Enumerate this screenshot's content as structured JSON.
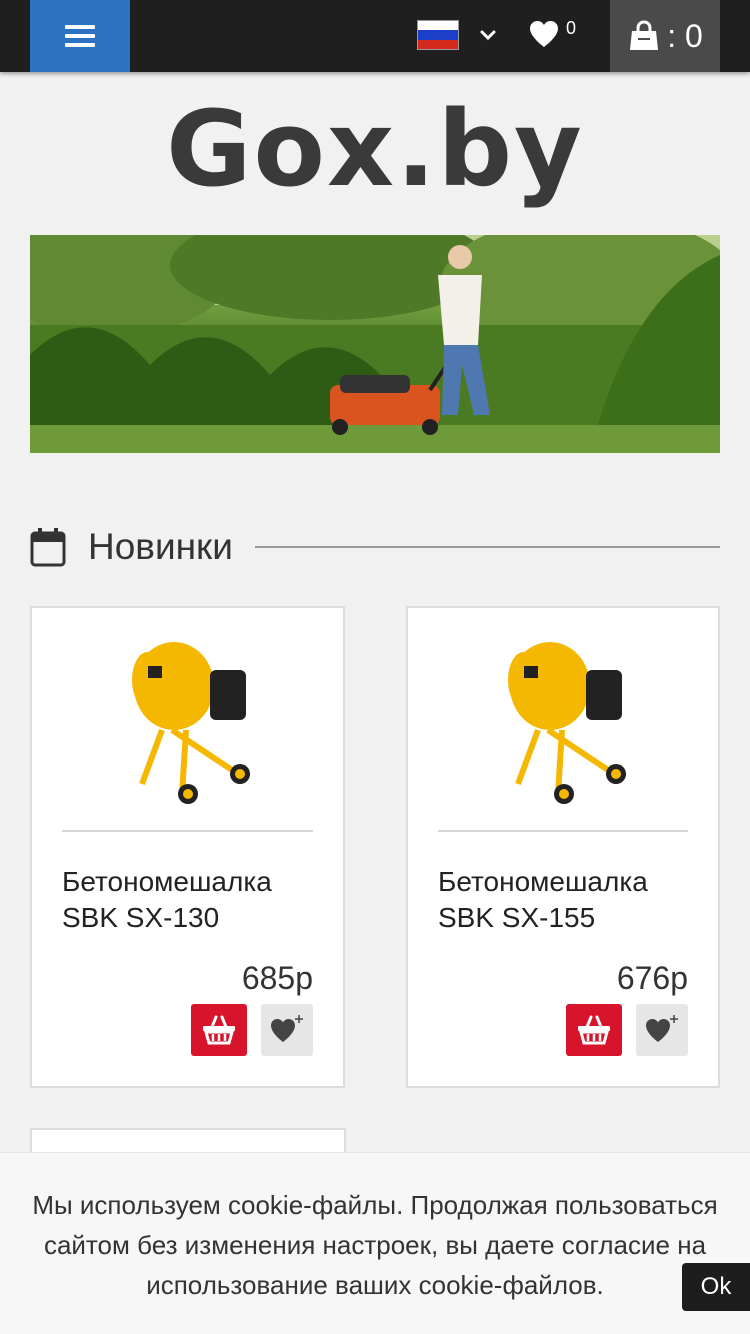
{
  "header": {
    "menu_icon": "hamburger-icon",
    "language_flag": "russia-flag-icon",
    "wishlist_count": "0",
    "cart_label": ": 0"
  },
  "logo": {
    "text": "Gox.by"
  },
  "banner": {
    "alt": "woman mowing lawn with red lawnmower"
  },
  "section": {
    "title": "Новинки",
    "icon": "calendar-icon"
  },
  "products": [
    {
      "name": "Бетономешалка SBK SX-130",
      "price": "685р"
    },
    {
      "name": "Бетономешалка SBK SX-155",
      "price": "676р"
    }
  ],
  "cookie": {
    "message": "Мы используем cookie-файлы. Продолжая пользоваться сайтом без изменения настроек, вы даете согласие на использование ваших cookie-файлов.",
    "ok_label": "Ok"
  },
  "colors": {
    "menu_blue": "#2b72c0",
    "topbar": "#1f1f1f",
    "cart_bg": "#4a4a4a",
    "add_to_cart_red": "#d8132c"
  }
}
